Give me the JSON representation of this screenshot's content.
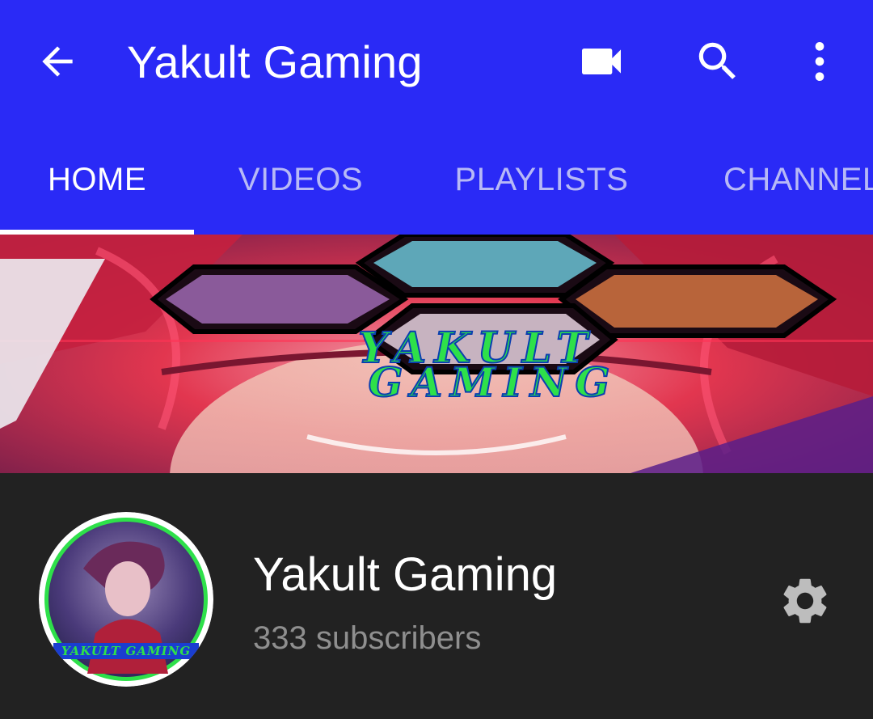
{
  "appbar": {
    "back_icon": "arrow-back-icon",
    "title": "Yakult Gaming",
    "actions": [
      {
        "icon": "video-camera-icon"
      },
      {
        "icon": "search-icon"
      },
      {
        "icon": "more-vert-icon"
      }
    ]
  },
  "tabs": [
    {
      "label": "HOME",
      "active": true
    },
    {
      "label": "VIDEOS",
      "active": false
    },
    {
      "label": "PLAYLISTS",
      "active": false
    },
    {
      "label": "CHANNELS",
      "active": false
    }
  ],
  "banner": {
    "text_line1": "YAKULT",
    "text_line2": "GAMING"
  },
  "channel": {
    "name": "Yakult Gaming",
    "subscribers": "333 subscribers",
    "avatar_text": "YAKULT GAMING"
  },
  "colors": {
    "appbar": "#2a2af6",
    "tab_inactive": "#b7b9f6",
    "background": "#222222",
    "subscribers_text": "#8f8f8f",
    "banner_text": "#2ee04a"
  }
}
